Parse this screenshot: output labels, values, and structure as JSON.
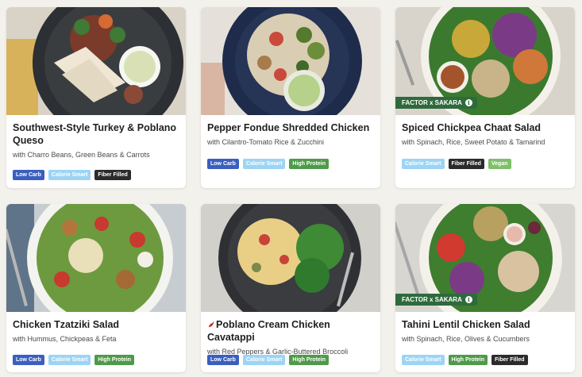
{
  "cards": [
    {
      "title": "Southwest-Style Turkey & Poblano Queso",
      "subtitle": "with Charro Beans, Green Beans & Carrots",
      "image": "turkey-plate",
      "tags": [
        "Low Carb",
        "Calorie Smart",
        "Fiber Filled"
      ]
    },
    {
      "title": "Pepper Fondue Shredded Chicken",
      "subtitle": "with Cilantro-Tomato Rice & Zucchini",
      "image": "chicken-rice-plate",
      "tags": [
        "Low Carb",
        "Calorie Smart",
        "High Protein"
      ]
    },
    {
      "title": "Spiced Chickpea Chaat Salad",
      "subtitle": "with Spinach, Rice, Sweet Potato & Tamarind",
      "image": "chickpea-salad",
      "badge": "FACTOR x SAKARA",
      "tags": [
        "Calorie Smart",
        "Fiber Filled",
        "Vegan"
      ]
    },
    {
      "title": "Chicken Tzatziki Salad",
      "subtitle": "with Hummus, Chickpeas & Feta",
      "image": "tzatziki-salad",
      "tags": [
        "Low Carb",
        "Calorie Smart",
        "High Protein"
      ]
    },
    {
      "title": "Poblano Cream Chicken Cavatappi",
      "subtitle": "with Red Peppers & Garlic-Buttered Broccoli",
      "image": "cavatappi-plate",
      "spicy": "chili-icon",
      "tags": [
        "Low Carb",
        "Calorie Smart",
        "High Protein"
      ]
    },
    {
      "title": "Tahini Lentil Chicken Salad",
      "subtitle": "with Spinach, Rice, Olives & Cucumbers",
      "image": "lentil-salad",
      "badge": "FACTOR x SAKARA",
      "tags": [
        "Calorie Smart",
        "High Protein",
        "Fiber Filled"
      ]
    }
  ],
  "tag_colors": {
    "Low Carb": "#3a5fc0",
    "Calorie Smart": "#9cd4f5",
    "Fiber Filled": "#2b2b2b",
    "High Protein": "#4f9a4a",
    "Vegan": "#7fbf6a"
  },
  "badge_color": "#2e6a3c",
  "info_icon": "info-icon"
}
